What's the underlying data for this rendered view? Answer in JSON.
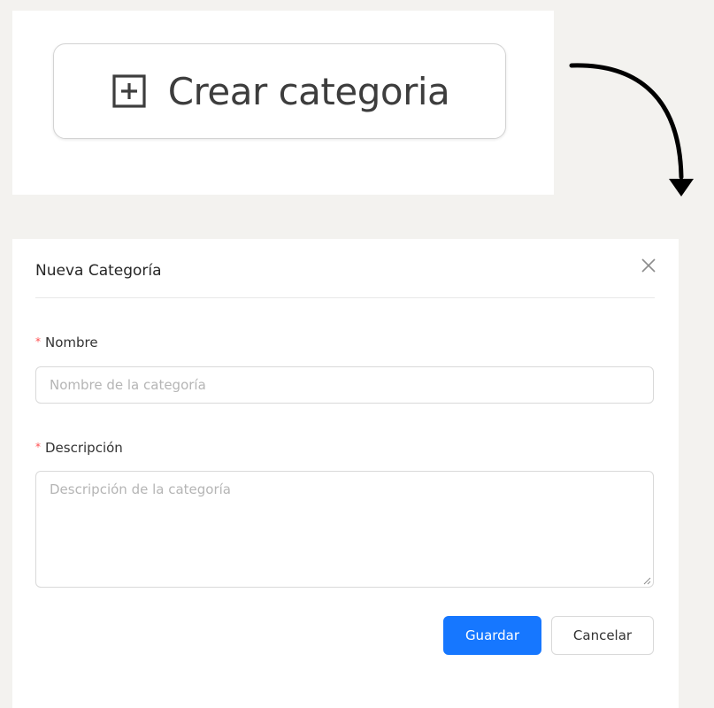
{
  "create_button": {
    "label": "Crear categoria",
    "icon": "plus-square-icon"
  },
  "modal": {
    "title": "Nueva Categoría",
    "close_icon": "close-icon",
    "fields": {
      "name": {
        "label": "Nombre",
        "required": true,
        "value": "",
        "placeholder": "Nombre de la categoría"
      },
      "description": {
        "label": "Descripción",
        "required": true,
        "value": "",
        "placeholder": "Descripción de la categoría"
      }
    },
    "buttons": {
      "save": "Guardar",
      "cancel": "Cancelar"
    }
  },
  "colors": {
    "primary": "#1677ff",
    "required_mark": "#ff4d4f",
    "background": "#f3f2ef"
  }
}
